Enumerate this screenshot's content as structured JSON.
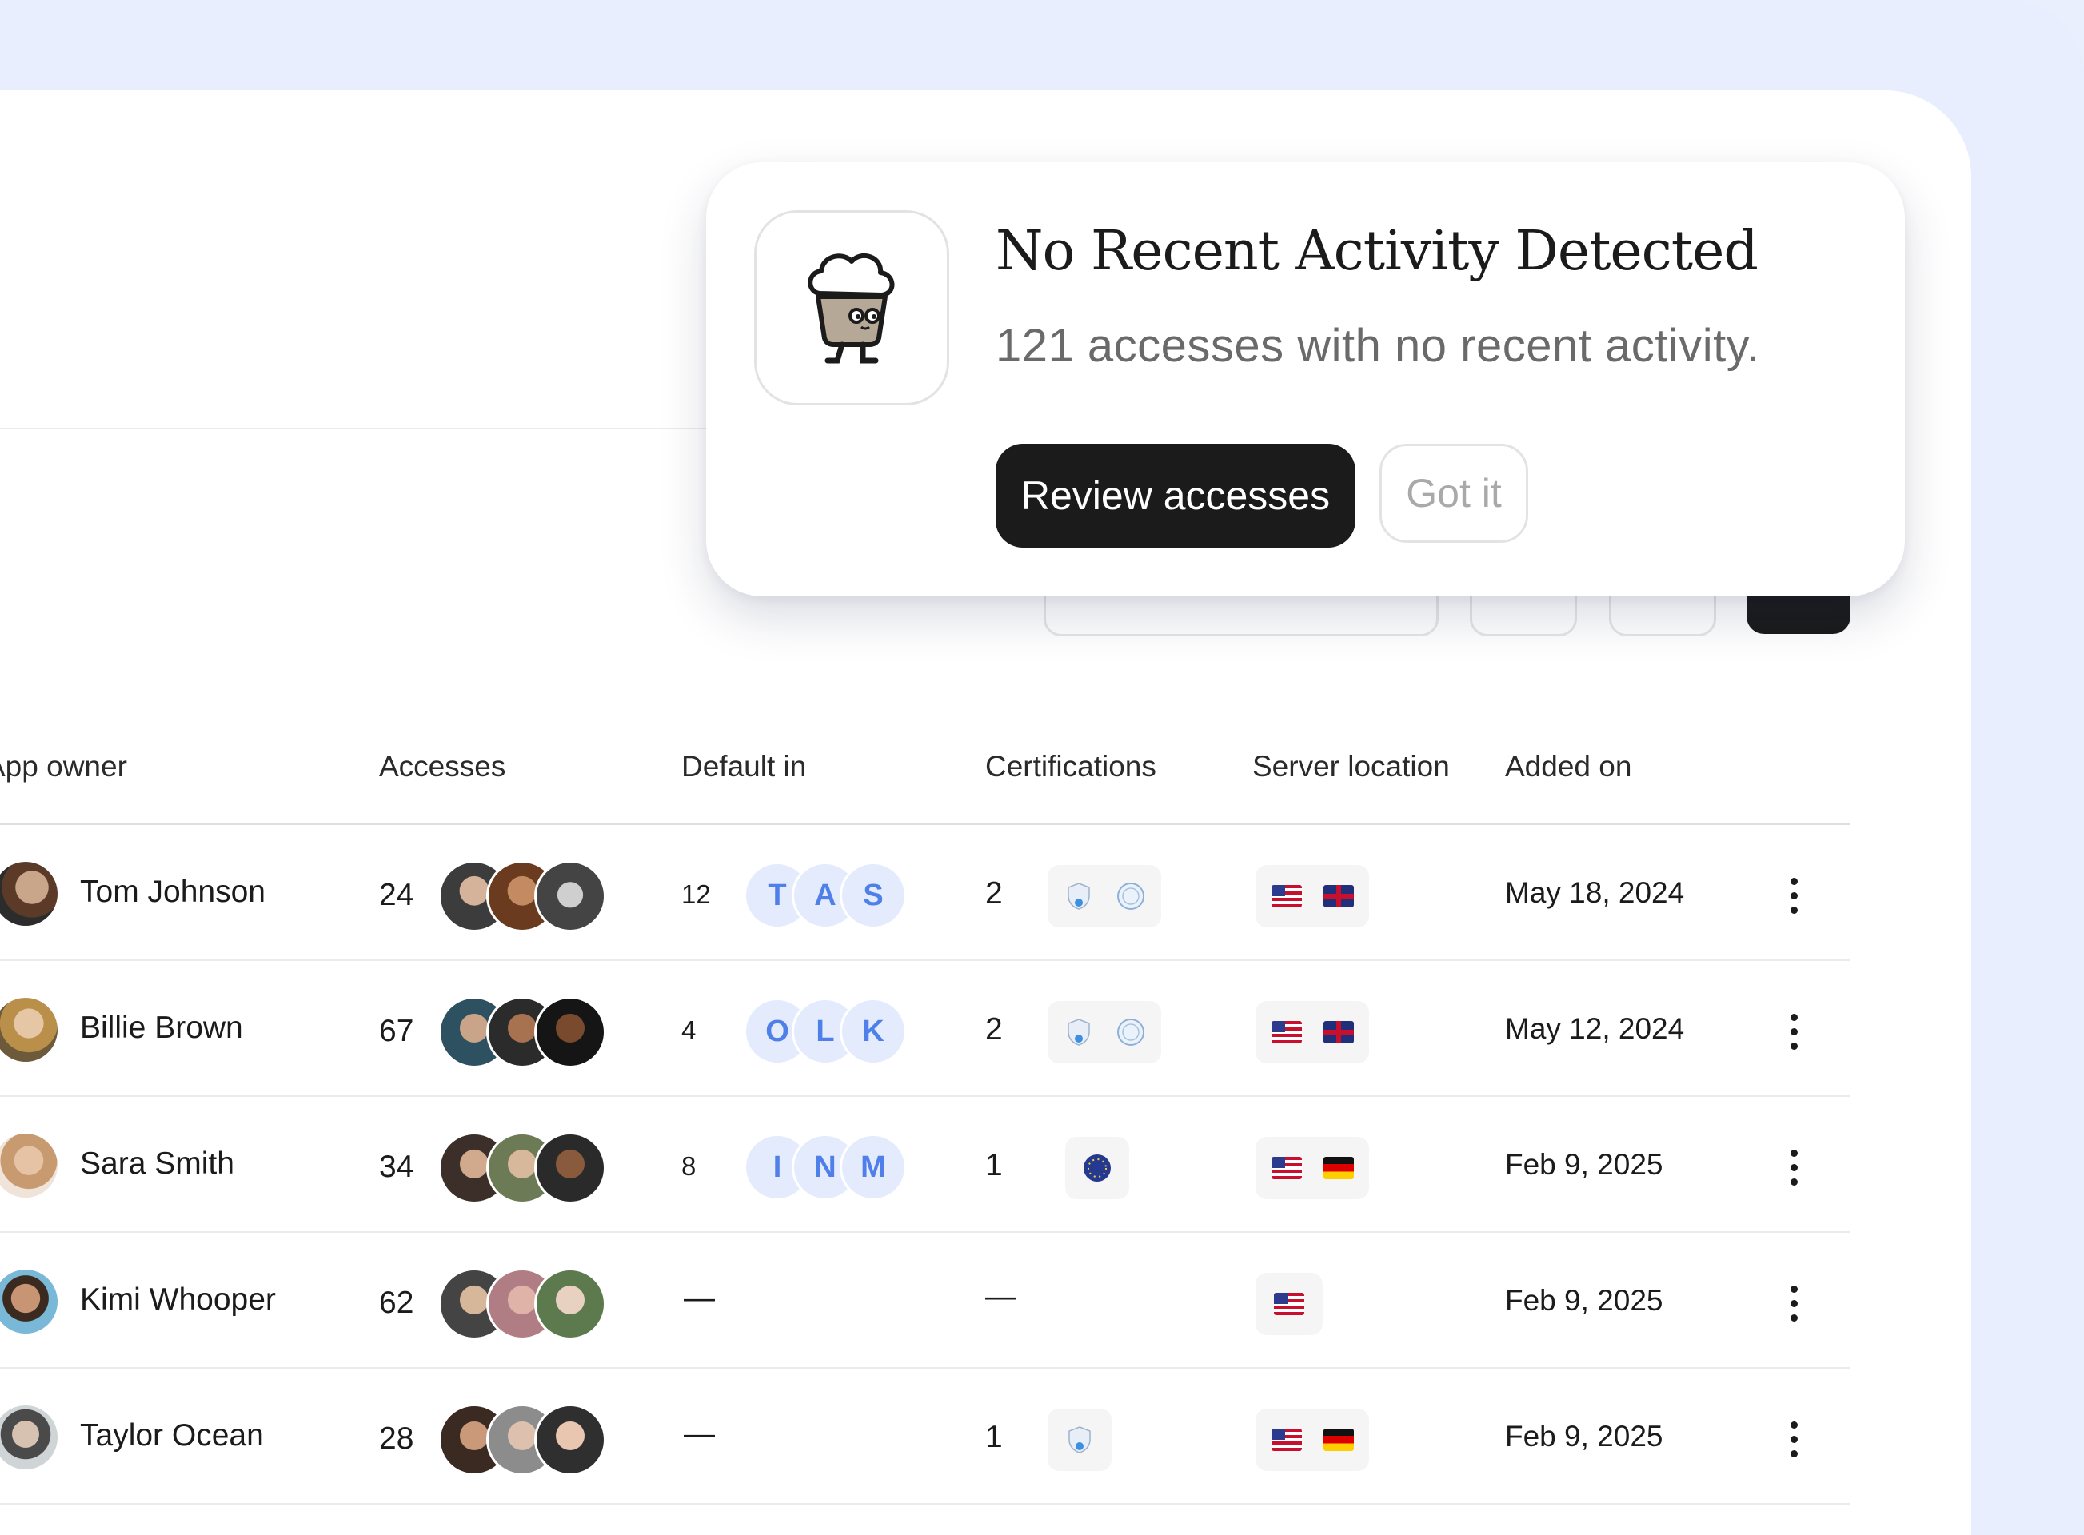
{
  "popup": {
    "title": "No Recent Activity Detected",
    "subtitle": "121 accesses with no recent activity.",
    "primary_button": "Review accesses",
    "secondary_button": "Got it",
    "mascot_icon": "cupcake-mascot-icon"
  },
  "table": {
    "headers": {
      "owner": "App owner",
      "accesses": "Accesses",
      "default_in": "Default in",
      "certifications": "Certifications",
      "server_location": "Server location",
      "added_on": "Added on"
    },
    "rows": [
      {
        "owner": "Tom Johnson",
        "accesses": "24",
        "default_count": "12",
        "default_letters": [
          "T",
          "A",
          "S"
        ],
        "cert_count": "2",
        "certs": [
          "soc2-badge-icon",
          "gdpr-seal-icon"
        ],
        "locations": [
          "us-flag-icon",
          "uk-flag-icon"
        ],
        "added_on": "May 18, 2024"
      },
      {
        "owner": "Billie Brown",
        "accesses": "67",
        "default_count": "4",
        "default_letters": [
          "O",
          "L",
          "K"
        ],
        "cert_count": "2",
        "certs": [
          "soc2-badge-icon",
          "gdpr-seal-icon"
        ],
        "locations": [
          "us-flag-icon",
          "uk-flag-icon"
        ],
        "added_on": "May 12, 2024"
      },
      {
        "owner": "Sara Smith",
        "accesses": "34",
        "default_count": "8",
        "default_letters": [
          "I",
          "N",
          "M"
        ],
        "cert_count": "1",
        "certs": [
          "eu-badge-icon"
        ],
        "locations": [
          "us-flag-icon",
          "de-flag-icon"
        ],
        "added_on": "Feb 9, 2025"
      },
      {
        "owner": "Kimi Whooper",
        "accesses": "62",
        "default_count": "—",
        "default_letters": [],
        "cert_count": "—",
        "certs": [],
        "locations": [
          "us-flag-icon"
        ],
        "added_on": "Feb 9, 2025"
      },
      {
        "owner": "Taylor Ocean",
        "accesses": "28",
        "default_count": "—",
        "default_letters": [],
        "cert_count": "1",
        "certs": [
          "soc2-badge-icon"
        ],
        "locations": [
          "us-flag-icon",
          "de-flag-icon"
        ],
        "added_on": "Feb 9, 2025"
      }
    ]
  }
}
